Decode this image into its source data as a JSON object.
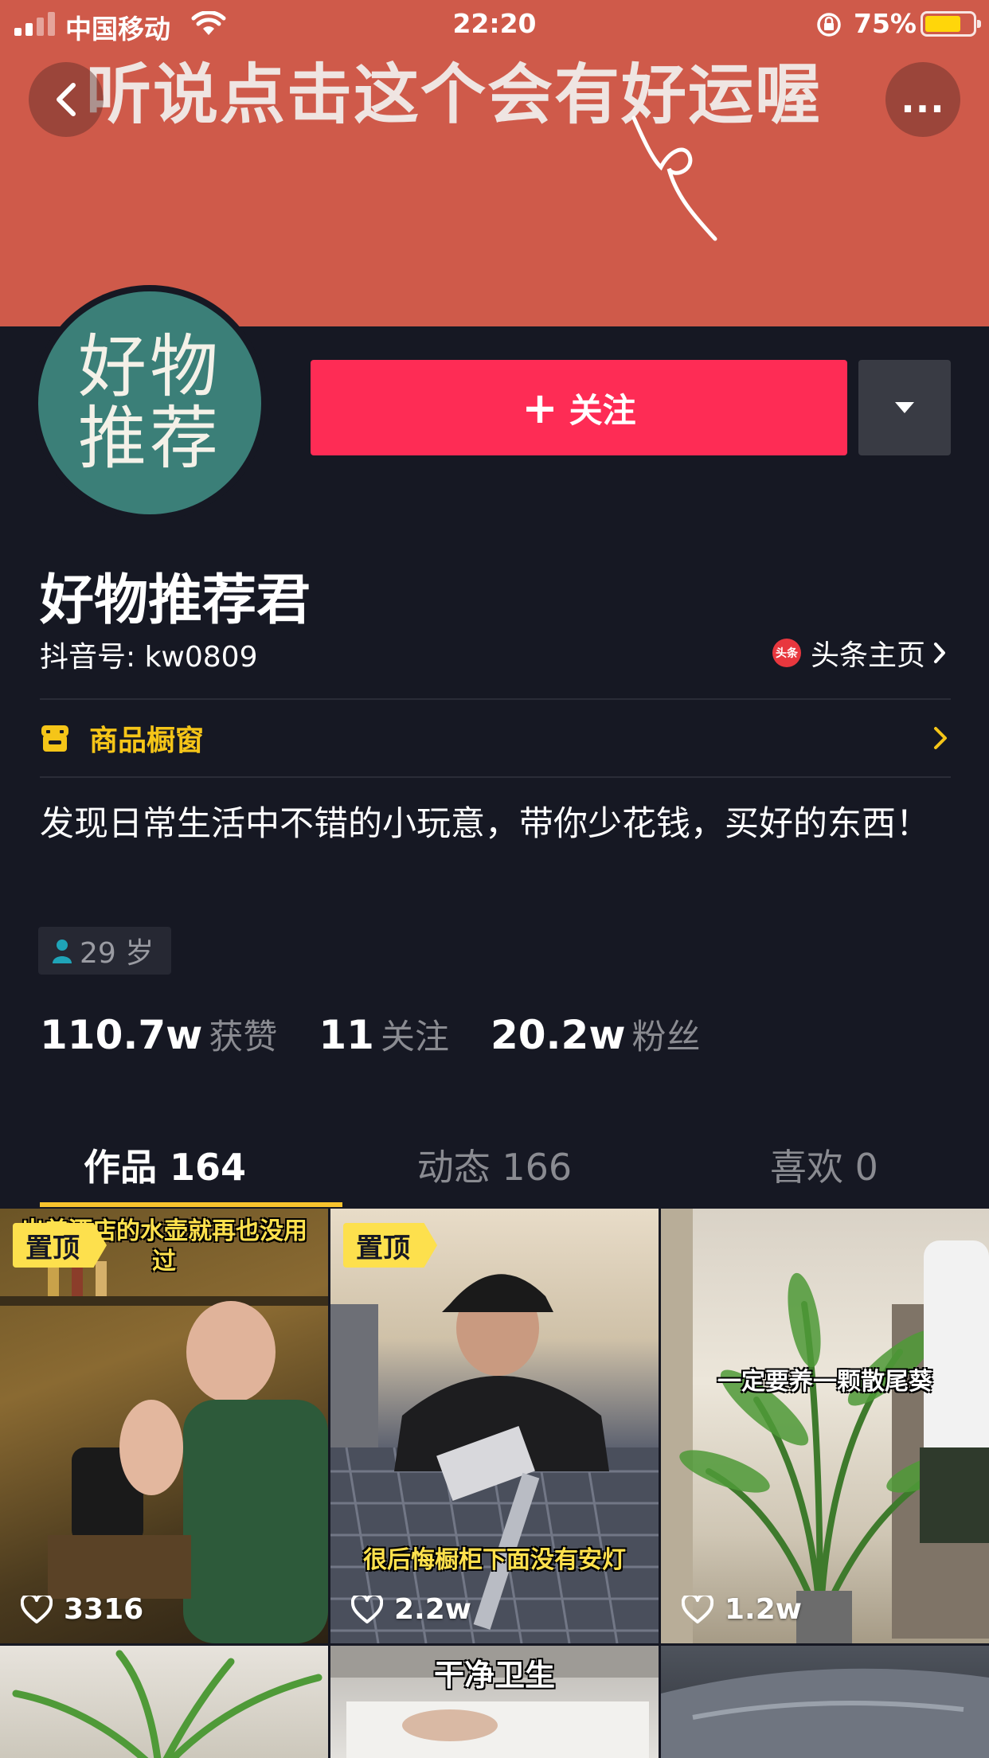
{
  "status_bar": {
    "carrier": "中国移动",
    "time": "22:20",
    "battery_percent": "75%",
    "battery_level": 0.75
  },
  "banner": {
    "text": "听说点击这个会有好运喔",
    "color": "#cf5a4a"
  },
  "nav": {
    "back_icon": "chevron-left-icon",
    "more_label": "..."
  },
  "avatar": {
    "line1": "好物",
    "line2": "推荐",
    "color": "#3b7f78"
  },
  "actions": {
    "follow_label": "关注",
    "follow_color": "#fe2c55",
    "dropdown_icon": "triangle-down-icon"
  },
  "profile": {
    "nickname": "好物推荐君",
    "douyin_id": "抖音号: kw0809",
    "toutiao_badge": "头条",
    "toutiao_label": "头条主页",
    "shop_label": "商品橱窗",
    "bio": "发现日常生活中不错的小玩意，带你少花钱，买好的东西！",
    "age": "29 岁"
  },
  "stats": [
    {
      "value": "110.7w",
      "label": "获赞"
    },
    {
      "value": "11",
      "label": "关注"
    },
    {
      "value": "20.2w",
      "label": "粉丝"
    }
  ],
  "tabs": [
    {
      "label": "作品 164",
      "active": true
    },
    {
      "label": "动态 166",
      "active": false
    },
    {
      "label": "喜欢 0",
      "active": false
    }
  ],
  "videos": [
    {
      "pinned": "置顶",
      "caption": "出差酒店的水壶就再也没用过",
      "likes": "3316"
    },
    {
      "pinned": "置顶",
      "caption": "很后悔橱柜下面没有安灯",
      "likes": "2.2w"
    },
    {
      "pinned": "",
      "caption": "一定要养一颗散尾葵",
      "likes": "1.2w"
    },
    {
      "pinned": "",
      "caption": "",
      "likes": ""
    },
    {
      "pinned": "",
      "caption": "干净卫生",
      "likes": ""
    },
    {
      "pinned": "",
      "caption": "",
      "likes": ""
    }
  ]
}
